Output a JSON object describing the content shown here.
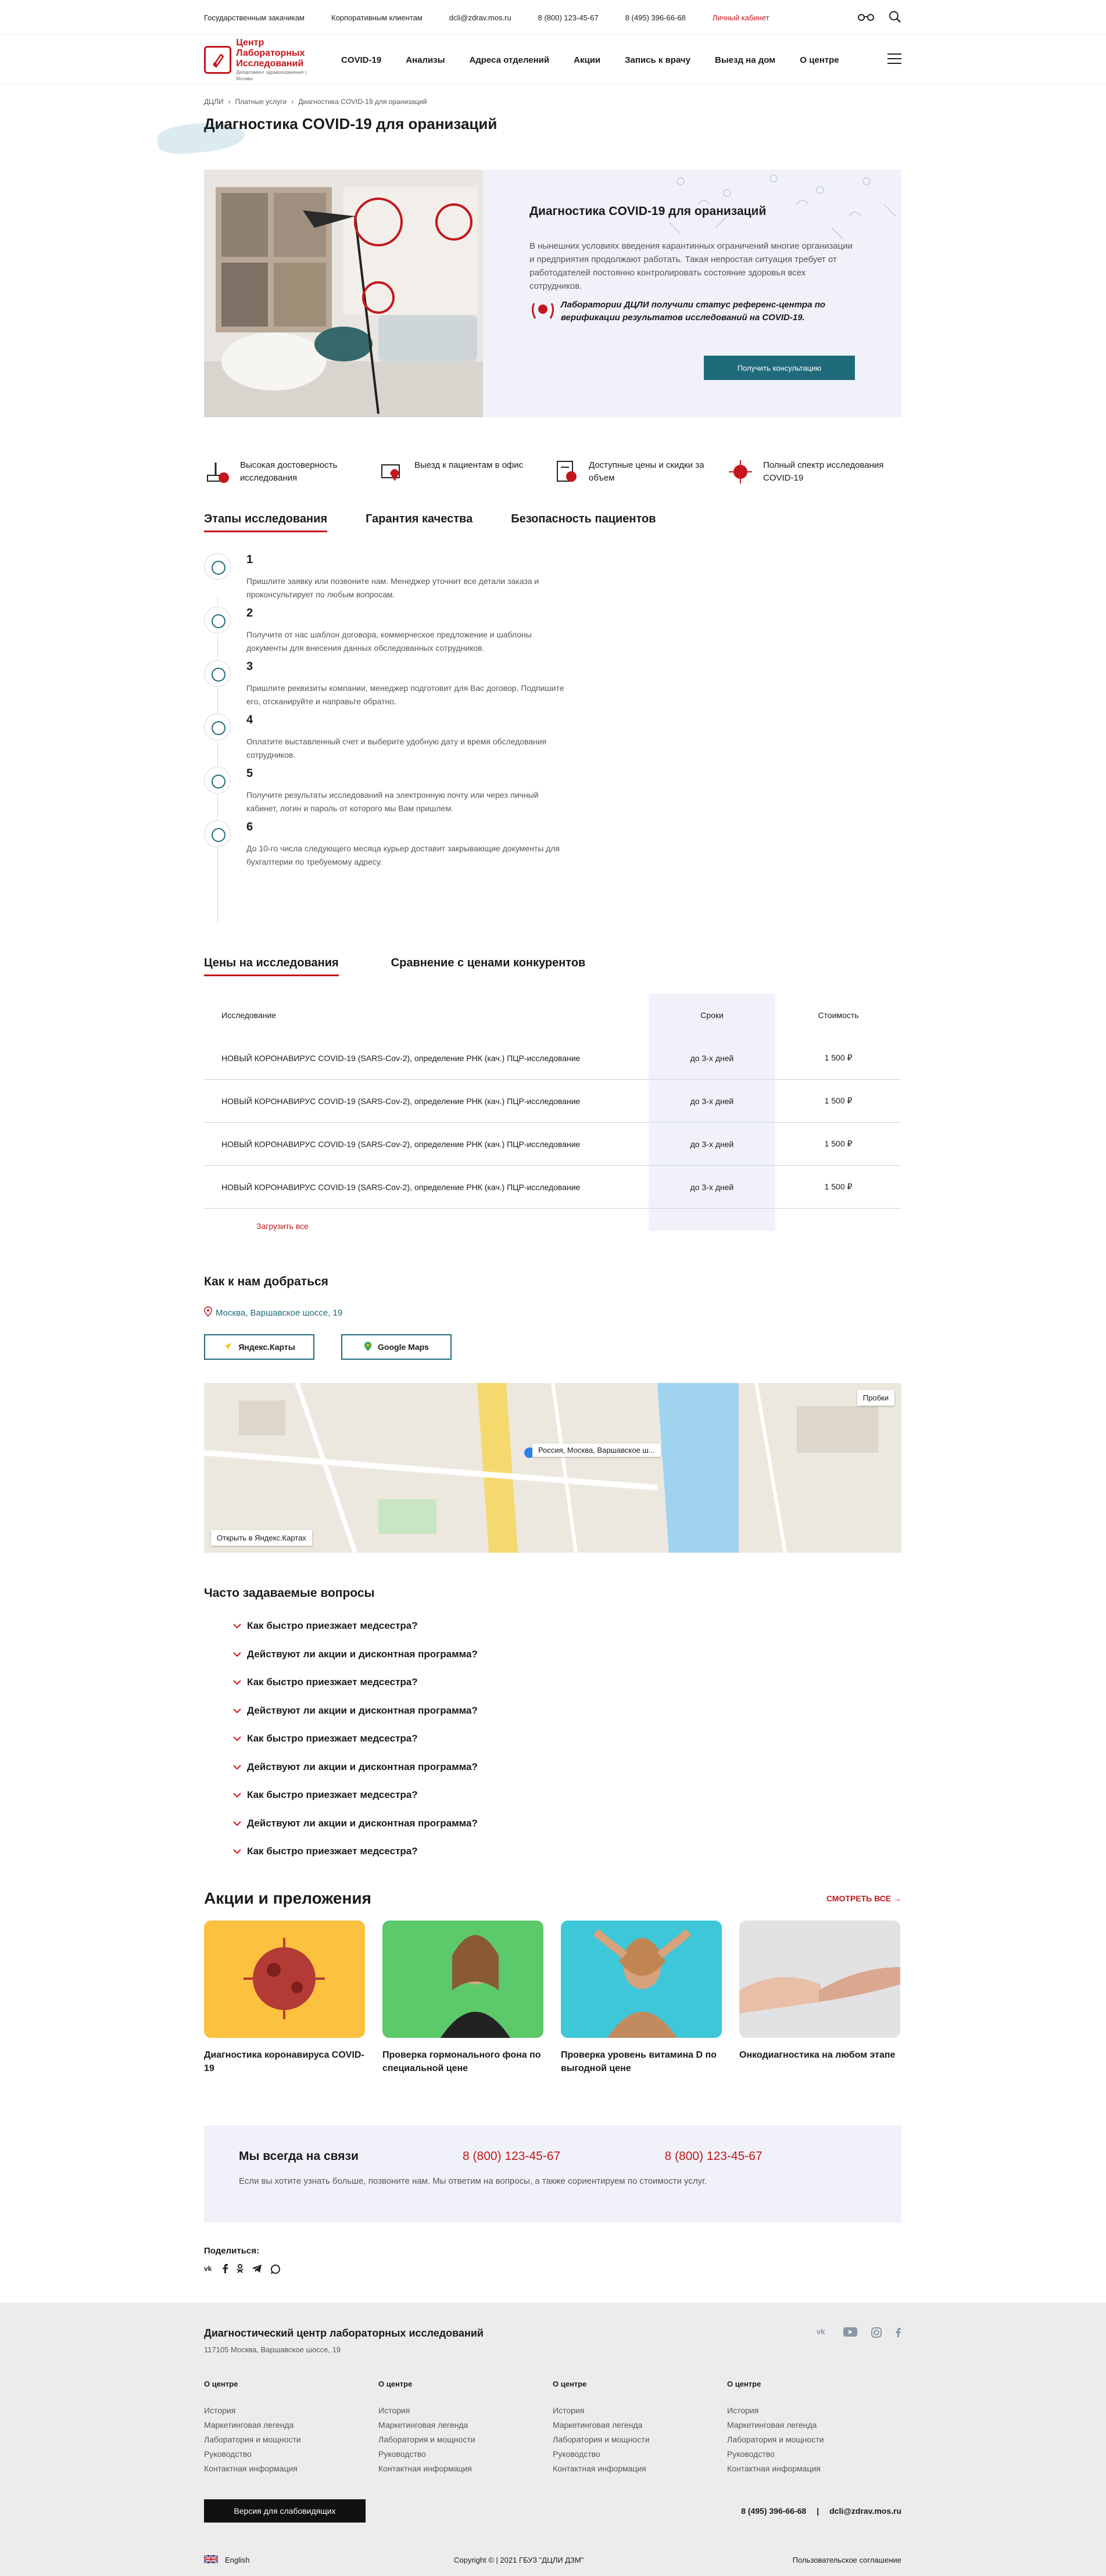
{
  "topbar": {
    "links": [
      "Государственным закачикам",
      "Корпоративным клиентам",
      "dcli@zdrav.mos.ru",
      "8 (800) 123-45-67",
      "8 (495) 396-66-68"
    ],
    "cabinet": "Личный кабинет"
  },
  "header": {
    "logo_line1": "Центр",
    "logo_line2": "Лабораторных",
    "logo_line3": "Исследований",
    "logo_sub": "Департамент здравоохранения г. Москвы",
    "nav": [
      "COVID-19",
      "Анализы",
      "Адреса отделений",
      "Акции",
      "Запись к врачу",
      "Выезд на дом",
      "О центре"
    ]
  },
  "breadcrumbs": [
    "ДЦЛИ",
    "Платные услуги",
    "Диагностика COVID-19 для оранизаций"
  ],
  "page_title": "Диагностика COVID-19 для оранизаций",
  "hero": {
    "title": "Диагностика COVID-19 для оранизаций",
    "text": "В нынешних условиях введения карантинных ограничений многие организации и предприятия продолжают работать. Такая непростая ситуация требует от работодателей постоянно контролировать состояние здоровья всех сотрудников.",
    "reference": "Лаборатории ДЦЛИ получили статус референс-центра по верификации результатов исследований на COVID-19.",
    "button": "Получить консультацию"
  },
  "features": [
    {
      "text": "Высокая достоверность исследования",
      "icon": "microscope-icon"
    },
    {
      "text": "Выезд к пациентам в офис",
      "icon": "office-visit-icon"
    },
    {
      "text": "Доступные цены и скидки за объем",
      "icon": "discount-icon"
    },
    {
      "text": "Полный спектр исследования COVID-19",
      "icon": "virus-icon"
    }
  ],
  "info_tabs": [
    "Этапы исследования",
    "Гарантия качества",
    "Безопасность пациентов"
  ],
  "steps": [
    {
      "num": "1",
      "text": "Пришлите заявку или позвоните нам. Менеджер уточнит все детали заказа и проконсультирует по любым вопросам."
    },
    {
      "num": "2",
      "text": "Получите от нас шаблон договора, коммерческое предложение и шаблоны документы для внесения данных обследованных сотрудников."
    },
    {
      "num": "3",
      "text": "Пришлите реквизиты компании, менеджер подготовит для Вас договор. Подпишите его, отсканируйте и направьте обратно."
    },
    {
      "num": "4",
      "text": "Оплатите выставленный счет и выберите удобную дату и время обследования сотрудников."
    },
    {
      "num": "5",
      "text": "Получите результаты исследований на электронную почту или через личный кабинет, логин и пароль от которого мы Вам пришлем."
    },
    {
      "num": "6",
      "text": "До 10-го числа следующего месяца курьер доставит закрывающие документы для бухгалтерии по требуемому адресу."
    }
  ],
  "price_tabs": [
    "Цены на исследования",
    "Сравнение с ценами конкурентов"
  ],
  "price_table": {
    "headers": [
      "Исследование",
      "Сроки",
      "Стоимость"
    ],
    "rows": [
      [
        "НОВЫЙ КОРОНАВИРУС COVID-19 (SARS-Cov-2), определение РНК (кач.) ПЦР-исследование",
        "до 3-х дней",
        "1 500 ₽"
      ],
      [
        "НОВЫЙ КОРОНАВИРУС COVID-19 (SARS-Cov-2), определение РНК (кач.) ПЦР-исследование",
        "до 3-х дней",
        "1 500 ₽"
      ],
      [
        "НОВЫЙ КОРОНАВИРУС COVID-19 (SARS-Cov-2), определение РНК (кач.) ПЦР-исследование",
        "до 3-х дней",
        "1 500 ₽"
      ],
      [
        "НОВЫЙ КОРОНАВИРУС COVID-19 (SARS-Cov-2), определение РНК (кач.) ПЦР-исследование",
        "до 3-х дней",
        "1 500 ₽"
      ]
    ],
    "load_more": "Загрузить все"
  },
  "directions": {
    "title": "Как к нам добраться",
    "address": "Москва, Варшавское шоссе, 19",
    "yandex_btn": "Яндекс.Карты",
    "google_btn": "Google Maps",
    "map_label": "Россия, Москва, Варшавское ш...",
    "map_open": "Открыть в Яндекс.Картах",
    "map_traffic": "Пробки"
  },
  "faq": {
    "title": "Часто задаваемые вопросы",
    "items": [
      "Как быстро приезжает медсестра?",
      "Действуют ли акции и дисконтная программа?",
      "Как быстро приезжает медсестра?",
      "Действуют ли акции и дисконтная программа?",
      "Как быстро приезжает медсестра?",
      "Действуют ли акции и дисконтная программа?",
      "Как быстро приезжает медсестра?",
      "Действуют ли акции и дисконтная программа?",
      "Как быстро приезжает медсестра?"
    ]
  },
  "promos": {
    "title": "Акции и преложения",
    "see_all": "СМОТРЕТЬ ВСЕ",
    "items": [
      {
        "caption": "Диагностика коронавируса COVID-19",
        "bg": "#fcc13e"
      },
      {
        "caption": "Проверка гормонального фона по специальной цене",
        "bg": "#5cc96a"
      },
      {
        "caption": "Проверка уровень витамина D по выгодной цене",
        "bg": "#3ec7d9"
      },
      {
        "caption": "Онкодиагностика на любом этапе",
        "bg": "#e2e2e4"
      }
    ]
  },
  "callbox": {
    "title": "Мы всегда на связи",
    "phone1": "8 (800) 123-45-67",
    "phone2": "8 (800) 123-45-67",
    "text": "Если вы хотите узнать больше, позвоните нам. Мы ответим на вопросы, а также сориентируем по стоимости услуг."
  },
  "share": {
    "label": "Поделиться:"
  },
  "footer": {
    "name": "Диагностический центр лабораторных исследований",
    "address": "117105 Москва, Варшавское шоссе, 19",
    "columns": [
      {
        "title": "О центре",
        "links": [
          "История",
          "Маркетинговая легенда",
          "Лаборатория и мощности",
          "Руководство",
          "Контактная информация"
        ]
      },
      {
        "title": "О центре",
        "links": [
          "История",
          "Маркетинговая легенда",
          "Лаборатория и мощности",
          "Руководство",
          "Контактная информация"
        ]
      },
      {
        "title": "О центре",
        "links": [
          "История",
          "Маркетинговая легенда",
          "Лаборатория и мощности",
          "Руководство",
          "Контактная информация"
        ]
      },
      {
        "title": "О центре",
        "links": [
          "История",
          "Маркетинговая легенда",
          "Лаборатория и мощности",
          "Руководство",
          "Контактная информация"
        ]
      }
    ],
    "visually_impaired": "Версия для слабовидящих",
    "phone": "8 (495) 396-66-68",
    "separator": "|",
    "email": "dcli@zdrav.mos.ru",
    "english": "English",
    "copyright": "Copyright © | 2021 ГБУЗ \"ДЦЛИ ДЗМ\"",
    "agreement": "Пользовательское соглашение"
  },
  "colors": {
    "brand_red": "#c4161c",
    "teal": "#1f6b7c",
    "light_panel": "#f1f2f9",
    "footer_bg": "#ececec"
  }
}
